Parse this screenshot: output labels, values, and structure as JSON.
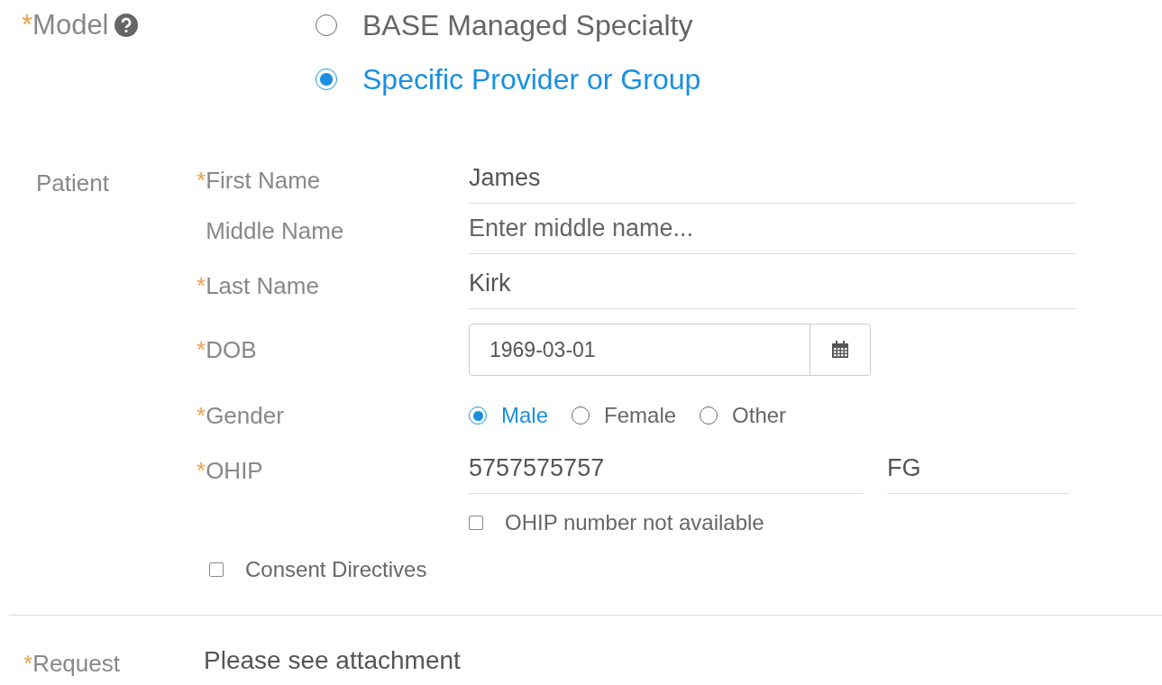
{
  "required_mark": "*",
  "model": {
    "label": "Model",
    "required": true,
    "options": [
      {
        "label": "BASE Managed Specialty",
        "selected": false
      },
      {
        "label": "Specific Provider or Group",
        "selected": true
      }
    ]
  },
  "patient": {
    "label": "Patient",
    "fields": [
      {
        "kind": "text",
        "label": "First Name",
        "required": true,
        "value": "James"
      },
      {
        "kind": "text",
        "label": "Middle Name",
        "required": false,
        "placeholder": "Enter middle name..."
      },
      {
        "kind": "text",
        "label": "Last Name",
        "required": true,
        "value": "Kirk"
      },
      {
        "kind": "date",
        "label": "DOB",
        "required": true,
        "value": "1969-03-01"
      },
      {
        "kind": "radio",
        "label": "Gender",
        "required": true,
        "options": [
          {
            "label": "Male",
            "selected": true
          },
          {
            "label": "Female",
            "selected": false
          },
          {
            "label": "Other",
            "selected": false
          }
        ]
      },
      {
        "kind": "ohip",
        "label": "OHIP",
        "required": true,
        "value": "5757575757",
        "version": "FG",
        "checkbox": {
          "label": "OHIP number not available",
          "checked": false
        }
      }
    ],
    "consent": {
      "label": "Consent Directives",
      "checked": false
    }
  },
  "request": {
    "label": "Request",
    "required": true,
    "value": "Please see attachment"
  }
}
